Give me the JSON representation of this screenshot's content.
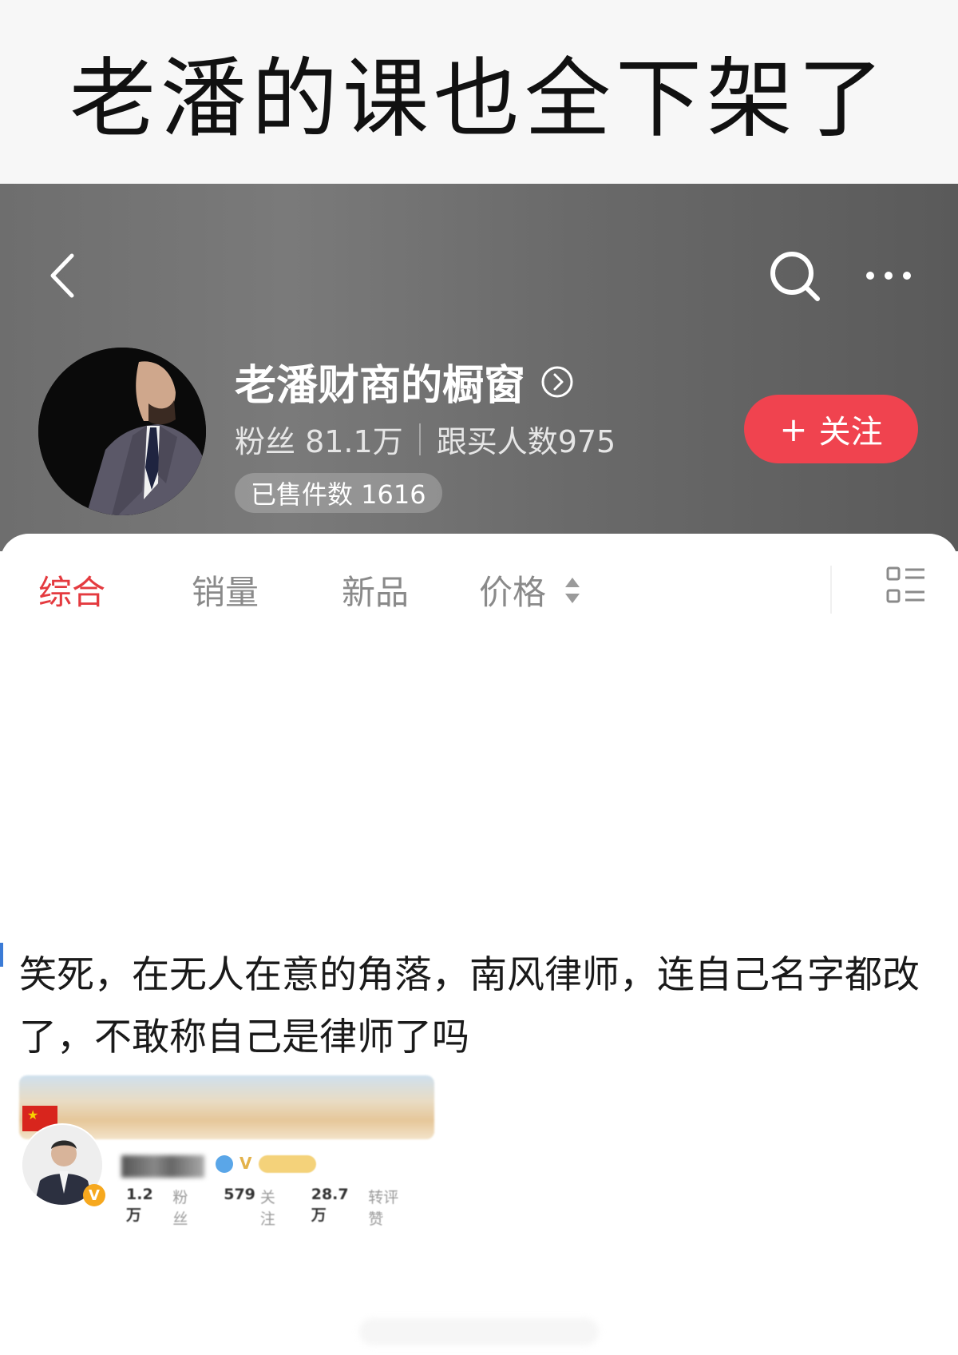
{
  "caption": {
    "text": "老潘的课也全下架了"
  },
  "header": {
    "store_name": "老潘财商的橱窗",
    "fans": "粉丝 81.1万",
    "buyers": "跟买人数975",
    "sold": "已售件数 1616",
    "follow_plus": "+",
    "follow_label": "关注"
  },
  "tabs": [
    {
      "label": "综合",
      "active": true
    },
    {
      "label": "销量",
      "active": false
    },
    {
      "label": "新品",
      "active": false
    },
    {
      "label": "价格",
      "active": false
    }
  ],
  "post": {
    "text": "笑死，在无人在意的角落，南风律师，连自己名字都改了，不敢称自己是律师了吗",
    "profile": {
      "fans_num": "1.2万",
      "fans_label": "粉丝",
      "follow_num": "579",
      "follow_label": "关注",
      "likes_num": "28.7万",
      "likes_label": "转评赞"
    }
  },
  "colors": {
    "accent": "#e43a3f",
    "follow_button": "#f0434f",
    "header_bg": "#6e6e6e"
  },
  "icons": {
    "back": "chevron-left-icon",
    "search": "search-icon",
    "more": "more-horizontal-icon",
    "name_arrow": "chevron-right-circle-icon",
    "sort": "sort-updown-icon",
    "layout": "list-layout-icon"
  }
}
